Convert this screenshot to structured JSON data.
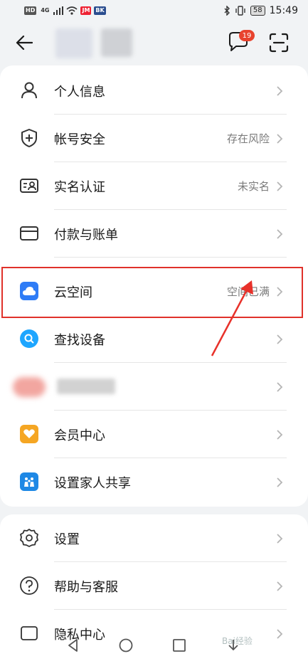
{
  "status_bar": {
    "left_chips": [
      "HD",
      "4G",
      "JM",
      "BK"
    ],
    "battery": "58",
    "time": "15:49"
  },
  "header": {
    "back_icon": "back-arrow-icon",
    "message_badge": "19",
    "message_icon": "message-icon",
    "scan_icon": "scan-icon"
  },
  "menu": [
    {
      "icon": "person-icon",
      "label": "个人信息",
      "value": ""
    },
    {
      "icon": "shield-plus-icon",
      "label": "帐号安全",
      "value": "存在风险"
    },
    {
      "icon": "id-card-icon",
      "label": "实名认证",
      "value": "未实名"
    },
    {
      "icon": "card-icon",
      "label": "付款与账单",
      "value": ""
    },
    {
      "icon": "cloud-icon",
      "label": "云空间",
      "value": "空间已满"
    },
    {
      "icon": "find-device-icon",
      "label": "查找设备",
      "value": ""
    },
    {
      "icon": "blurred-icon",
      "label": "",
      "value": ""
    },
    {
      "icon": "member-heart-icon",
      "label": "会员中心",
      "value": ""
    },
    {
      "icon": "family-share-icon",
      "label": "设置家人共享",
      "value": ""
    }
  ],
  "menu2": [
    {
      "icon": "gear-icon",
      "label": "设置",
      "value": ""
    },
    {
      "icon": "help-icon",
      "label": "帮助与客服",
      "value": ""
    },
    {
      "icon": "privacy-icon",
      "label": "隐私中心",
      "value": ""
    }
  ],
  "colors": {
    "highlight": "#e0312a",
    "badge": "#e8432e",
    "cloud_blue": "#2f7cf6",
    "find_blue": "#1ea6ff",
    "member_orange": "#f5a623"
  },
  "nav": [
    "back-triangle-icon",
    "home-circle-icon",
    "recent-square-icon"
  ],
  "watermark": "Bai经验"
}
